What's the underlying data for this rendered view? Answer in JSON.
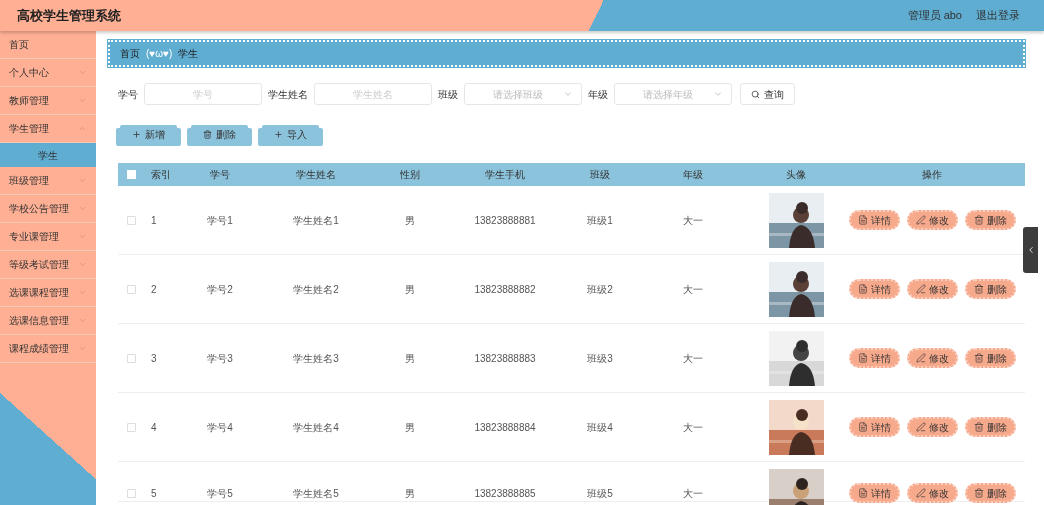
{
  "header": {
    "title": "高校学生管理系统",
    "user": "管理员 abo",
    "logout": "退出登录"
  },
  "sidebar": {
    "items": [
      {
        "label": "首页",
        "kind": "link"
      },
      {
        "label": "个人中心",
        "kind": "menu",
        "expanded": false
      },
      {
        "label": "教师管理",
        "kind": "menu",
        "expanded": false
      },
      {
        "label": "学生管理",
        "kind": "menu",
        "expanded": true,
        "children": [
          {
            "label": "学生",
            "selected": true
          }
        ]
      },
      {
        "label": "班级管理",
        "kind": "menu",
        "expanded": false
      },
      {
        "label": "学校公告管理",
        "kind": "menu",
        "expanded": false
      },
      {
        "label": "专业课管理",
        "kind": "menu",
        "expanded": false
      },
      {
        "label": "等级考试管理",
        "kind": "menu",
        "expanded": false
      },
      {
        "label": "选课课程管理",
        "kind": "menu",
        "expanded": false
      },
      {
        "label": "选课信息管理",
        "kind": "menu",
        "expanded": false
      },
      {
        "label": "课程成绩管理",
        "kind": "menu",
        "expanded": false
      }
    ]
  },
  "breadcrumb": {
    "items": [
      "首页",
      "学生"
    ],
    "separator": "(♥ω♥)"
  },
  "filters": [
    {
      "label": "学号",
      "kind": "text",
      "placeholder": "学号"
    },
    {
      "label": "学生姓名",
      "kind": "text",
      "placeholder": "学生姓名"
    },
    {
      "label": "班级",
      "kind": "select",
      "placeholder": "请选择班级"
    },
    {
      "label": "年级",
      "kind": "select",
      "placeholder": "请选择年级"
    }
  ],
  "search_button": "查询",
  "toolbar": [
    {
      "label": "新增",
      "kind": "add"
    },
    {
      "label": "删除",
      "kind": "delete"
    },
    {
      "label": "导入",
      "kind": "add"
    }
  ],
  "table": {
    "columns": [
      "索引",
      "学号",
      "学生姓名",
      "性别",
      "学生手机",
      "班级",
      "年级",
      "头像",
      "操作"
    ],
    "all_checked": false,
    "rows": [
      {
        "checked": false,
        "cells": [
          "1",
          "学号1",
          "学生姓名1",
          "男",
          "13823888881",
          "班级1",
          "大一"
        ],
        "actions": [
          {
            "label": "详情",
            "kind": "detail"
          },
          {
            "label": "修改",
            "kind": "edit"
          },
          {
            "label": "删除",
            "kind": "delete"
          }
        ]
      },
      {
        "checked": false,
        "cells": [
          "2",
          "学号2",
          "学生姓名2",
          "男",
          "13823888882",
          "班级2",
          "大一"
        ],
        "actions": [
          {
            "label": "详情",
            "kind": "detail"
          },
          {
            "label": "修改",
            "kind": "edit"
          },
          {
            "label": "删除",
            "kind": "delete"
          }
        ]
      },
      {
        "checked": false,
        "cells": [
          "3",
          "学号3",
          "学生姓名3",
          "男",
          "13823888883",
          "班级3",
          "大一"
        ],
        "actions": [
          {
            "label": "详情",
            "kind": "detail"
          },
          {
            "label": "修改",
            "kind": "edit"
          },
          {
            "label": "删除",
            "kind": "delete"
          }
        ]
      },
      {
        "checked": false,
        "cells": [
          "4",
          "学号4",
          "学生姓名4",
          "男",
          "13823888884",
          "班级4",
          "大一"
        ],
        "actions": [
          {
            "label": "详情",
            "kind": "detail"
          },
          {
            "label": "修改",
            "kind": "edit"
          },
          {
            "label": "删除",
            "kind": "delete"
          }
        ]
      },
      {
        "checked": false,
        "cells": [
          "5",
          "学号5",
          "学生姓名5",
          "男",
          "13823888885",
          "班级5",
          "大一"
        ],
        "actions": [
          {
            "label": "详情",
            "kind": "detail"
          },
          {
            "label": "修改",
            "kind": "edit"
          },
          {
            "label": "删除",
            "kind": "delete"
          }
        ]
      }
    ]
  }
}
